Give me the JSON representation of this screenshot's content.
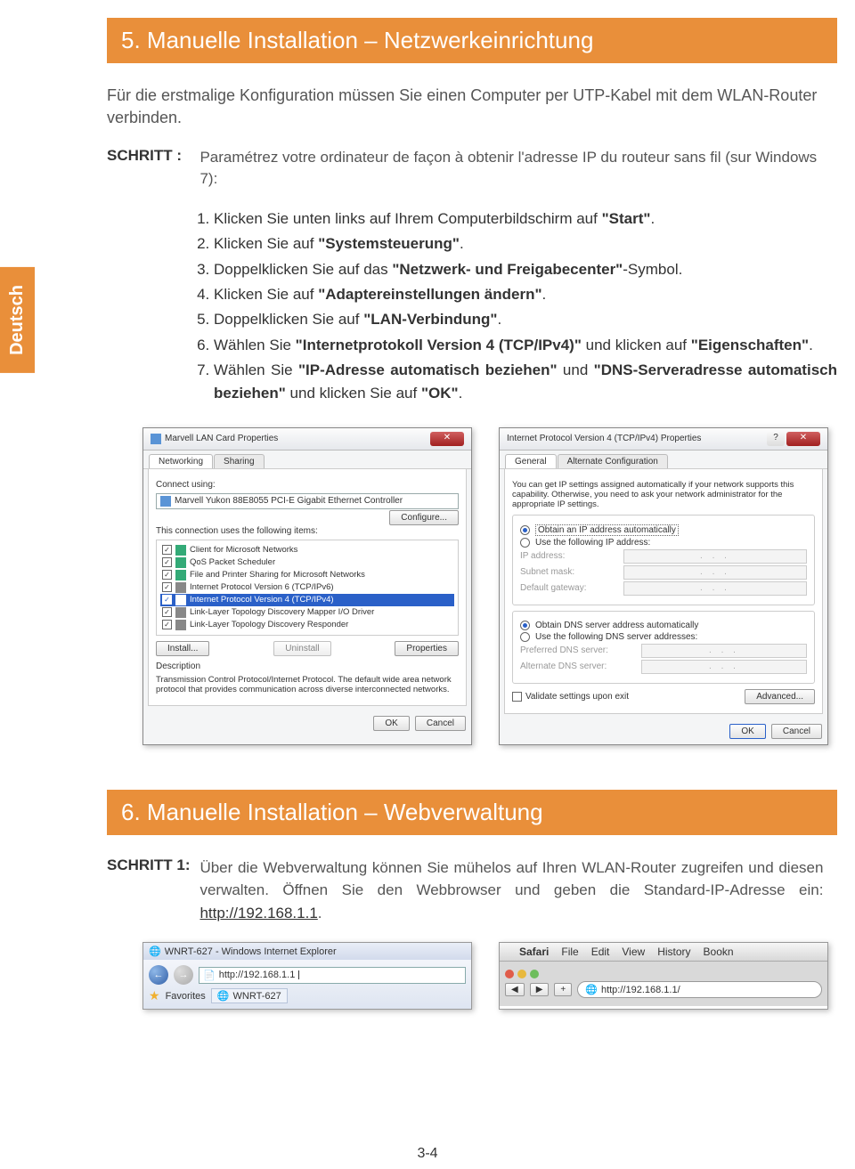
{
  "side_tab": "Deutsch",
  "section5": {
    "title": "5. Manuelle Installation – Netzwerkeinrichtung",
    "intro": "Für die erstmalige Konfiguration müssen Sie einen Computer per UTP-Kabel mit dem WLAN-Router verbinden.",
    "schritt_label": "SCHRITT :",
    "schritt_text": "Paramétrez votre ordinateur de façon à obtenir l'adresse IP du routeur sans fil (sur Windows 7):",
    "steps": [
      "Klicken Sie unten links auf Ihrem Computerbildschirm auf \"Start\".",
      "Klicken Sie auf \"Systemsteuerung\".",
      "Doppelklicken Sie auf das \"Netzwerk- und Freigabecenter\"-Symbol.",
      "Klicken Sie auf \"Adaptereinstellungen ändern\".",
      "Doppelklicken Sie auf \"LAN-Verbindung\".",
      "Wählen Sie \"Internetprotokoll Version 4 (TCP/IPv4)\" und klicken auf \"Eigenschaften\".",
      "Wählen Sie \"IP-Adresse automatisch beziehen\" und \"DNS-Serveradresse automatisch beziehen\" und klicken Sie auf \"OK\"."
    ]
  },
  "dlg_lan": {
    "title": "Marvell LAN Card Properties",
    "tabs": [
      "Networking",
      "Sharing"
    ],
    "connect_using_label": "Connect using:",
    "adapter": "Marvell Yukon 88E8055 PCI-E Gigabit Ethernet Controller",
    "configure_btn": "Configure...",
    "uses_label": "This connection uses the following items:",
    "items": [
      "Client for Microsoft Networks",
      "QoS Packet Scheduler",
      "File and Printer Sharing for Microsoft Networks",
      "Internet Protocol Version 6 (TCP/IPv6)",
      "Internet Protocol Version 4 (TCP/IPv4)",
      "Link-Layer Topology Discovery Mapper I/O Driver",
      "Link-Layer Topology Discovery Responder"
    ],
    "install_btn": "Install...",
    "uninstall_btn": "Uninstall",
    "properties_btn": "Properties",
    "desc_label": "Description",
    "desc_text": "Transmission Control Protocol/Internet Protocol. The default wide area network protocol that provides communication across diverse interconnected networks.",
    "ok_btn": "OK",
    "cancel_btn": "Cancel"
  },
  "dlg_ip": {
    "title": "Internet Protocol Version 4 (TCP/IPv4) Properties",
    "tabs": [
      "General",
      "Alternate Configuration"
    ],
    "info": "You can get IP settings assigned automatically if your network supports this capability. Otherwise, you need to ask your network administrator for the appropriate IP settings.",
    "r_auto_ip": "Obtain an IP address automatically",
    "r_use_ip": "Use the following IP address:",
    "ip_addr": "IP address:",
    "subnet": "Subnet mask:",
    "gateway": "Default gateway:",
    "r_auto_dns": "Obtain DNS server address automatically",
    "r_use_dns": "Use the following DNS server addresses:",
    "pref_dns": "Preferred DNS server:",
    "alt_dns": "Alternate DNS server:",
    "validate": "Validate settings upon exit",
    "advanced_btn": "Advanced...",
    "ok_btn": "OK",
    "cancel_btn": "Cancel"
  },
  "section6": {
    "title": "6. Manuelle Installation – Webverwaltung",
    "schritt_label": "SCHRITT 1:",
    "text_a": "Über die Webverwaltung können Sie mühelos auf Ihren WLAN-Router zugreifen und diesen verwalten. Öffnen Sie den Webbrowser und geben die Standard-IP-Adresse ein: ",
    "url": "http://192.168.1.1",
    "dot": "."
  },
  "ie": {
    "title": "WNRT-627 - Windows Internet Explorer",
    "url": "http://192.168.1.1",
    "favorites": "Favorites",
    "tab": "WNRT-627"
  },
  "safari": {
    "menu": [
      "Safari",
      "File",
      "Edit",
      "View",
      "History",
      "Bookn"
    ],
    "url": "http://192.168.1.1/"
  },
  "page_num": "3-4"
}
